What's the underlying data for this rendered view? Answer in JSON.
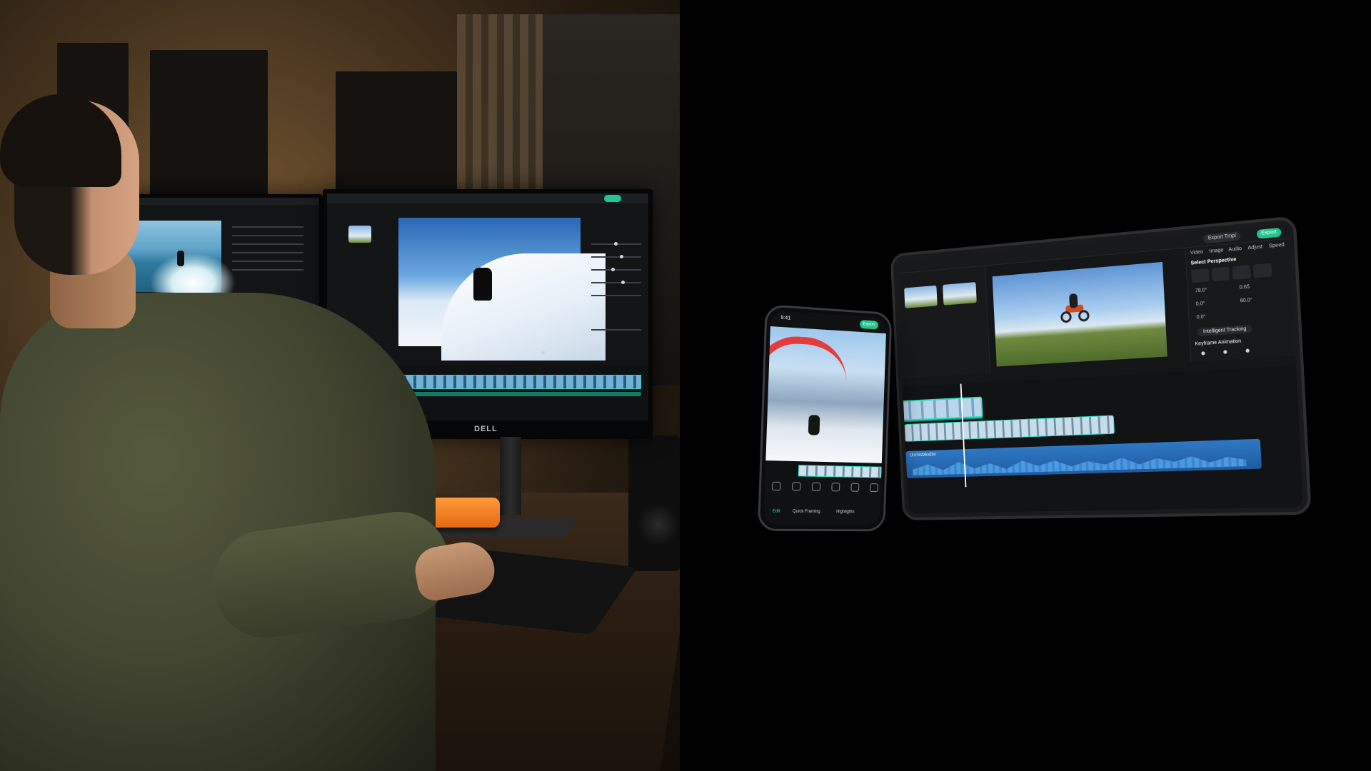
{
  "photo": {
    "monitor_brand": "DELL"
  },
  "tablet": {
    "export_button": "Export",
    "template_button": "Export Tmpl",
    "panel_title": "Select Perspective",
    "intelligent_tracking": "Intelligent Tracking",
    "keyframe_animation": "Keyframe Animation",
    "audio_track_label": "Unmistakable",
    "values": {
      "v1": "78.0°",
      "v2": "0.65",
      "v3": "0.0°",
      "v4": "60.0°",
      "v5": "0.0°"
    },
    "tabs": [
      "Video",
      "Image",
      "Audio",
      "Adjust",
      "Speed"
    ]
  },
  "phone": {
    "time": "9:41",
    "export_button": "Export",
    "tabs": [
      "Edit",
      "Quick Framing",
      "Highlights"
    ]
  },
  "colors": {
    "accent": "#22c58b",
    "clip_border": "#2fe0bd",
    "audio_track": "#2f78c4",
    "drive_orange": "#f07d22"
  }
}
